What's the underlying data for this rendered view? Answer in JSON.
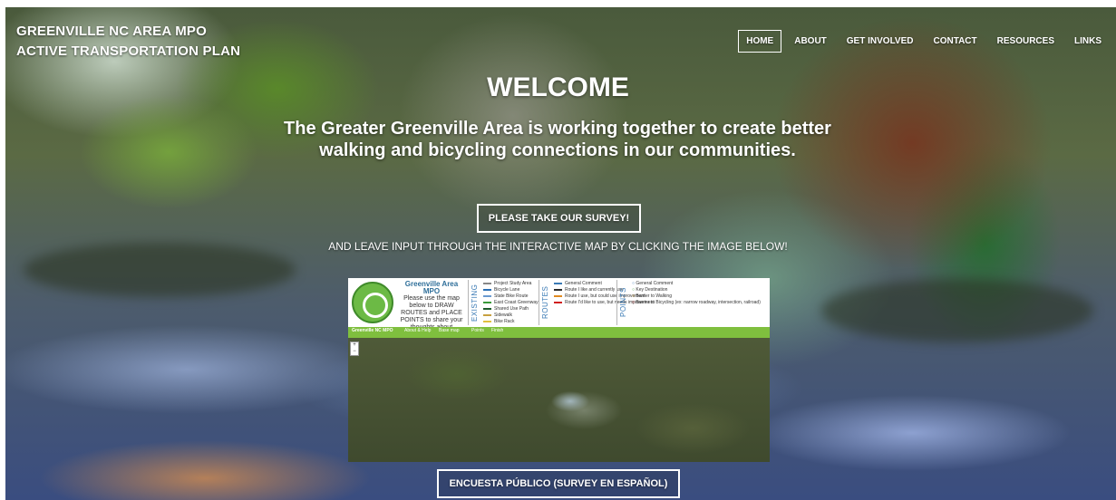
{
  "site": {
    "title_line1": "GREENVILLE NC AREA MPO",
    "title_line2": "ACTIVE TRANSPORTATION PLAN"
  },
  "nav": {
    "items": [
      {
        "label": "HOME",
        "active": true
      },
      {
        "label": "ABOUT",
        "active": false
      },
      {
        "label": "GET INVOLVED",
        "active": false
      },
      {
        "label": "CONTACT",
        "active": false
      },
      {
        "label": "RESOURCES",
        "active": false
      },
      {
        "label": "LINKS",
        "active": false
      }
    ]
  },
  "hero": {
    "heading": "WELCOME",
    "tagline": "The Greater Greenville Area is working together to create better walking and bicycling connections in our communities.",
    "survey_button": "PLEASE TAKE OUR SURVEY!",
    "instruction": "AND LEAVE INPUT THROUGH THE INTERACTIVE MAP BY CLICKING THE IMAGE BELOW!",
    "spanish_button": "ENCUESTA PÚBLICO (SURVEY EN ESPAÑOL)"
  },
  "map_preview": {
    "brand_title": "Greenville Area MPO",
    "brand_text": "Please use the map below to DRAW ROUTES and PLACE POINTS to share your thoughts about bicycling and walking in Greenville.",
    "existing_label": "EXISTING",
    "existing_items": [
      "Project Study Area",
      "Bicycle Lane",
      "State Bike Route",
      "East Coast Greenway",
      "Shared Use Path",
      "Sidewalk",
      "Bike Rack"
    ],
    "routes_label": "ROUTES",
    "routes_items": [
      "General Comment",
      "Route I like and currently use",
      "Route I use, but could use improvement",
      "Route I'd like to use, but needs improvement"
    ],
    "points_label": "POINTS",
    "points_items": [
      "General Comment",
      "Key Destination",
      "Barrier to Walking",
      "Barrier to Bicycling (ex: narrow roadway, intersection, railroad)"
    ],
    "nav_items": [
      "Greenville NC MPO",
      "About & Help",
      "Base map",
      "Points",
      "Finish"
    ],
    "colors": {
      "green": "#7fbf3e",
      "brand_blue": "#2f6f9a"
    }
  }
}
